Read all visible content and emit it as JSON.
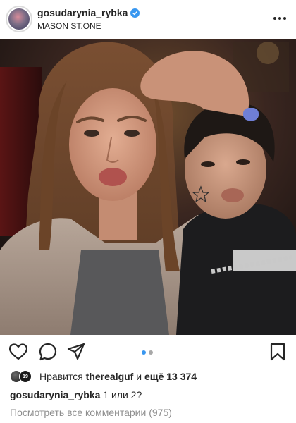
{
  "post": {
    "username": "gosudarynia_rybka",
    "location": "MASON ST.ONE",
    "verified": true
  },
  "icons": {
    "verified": "verified-badge-icon",
    "more": "more-options-icon",
    "like": "heart-icon",
    "comment": "comment-icon",
    "share": "paper-plane-icon",
    "save": "bookmark-icon"
  },
  "carousel": {
    "total": 2,
    "active_index": 0
  },
  "likes": {
    "prefix": "Нравится",
    "user": "therealguf",
    "connector": "и",
    "count_text": "ещё 13 374"
  },
  "caption": {
    "username": "gosudarynia_rybka",
    "text": "1 или 2?"
  },
  "comments": {
    "view_all": "Посмотреть все комментарии (975)"
  },
  "colors": {
    "accent": "#3897f0",
    "text": "#262626",
    "muted": "#8e8e8e"
  }
}
